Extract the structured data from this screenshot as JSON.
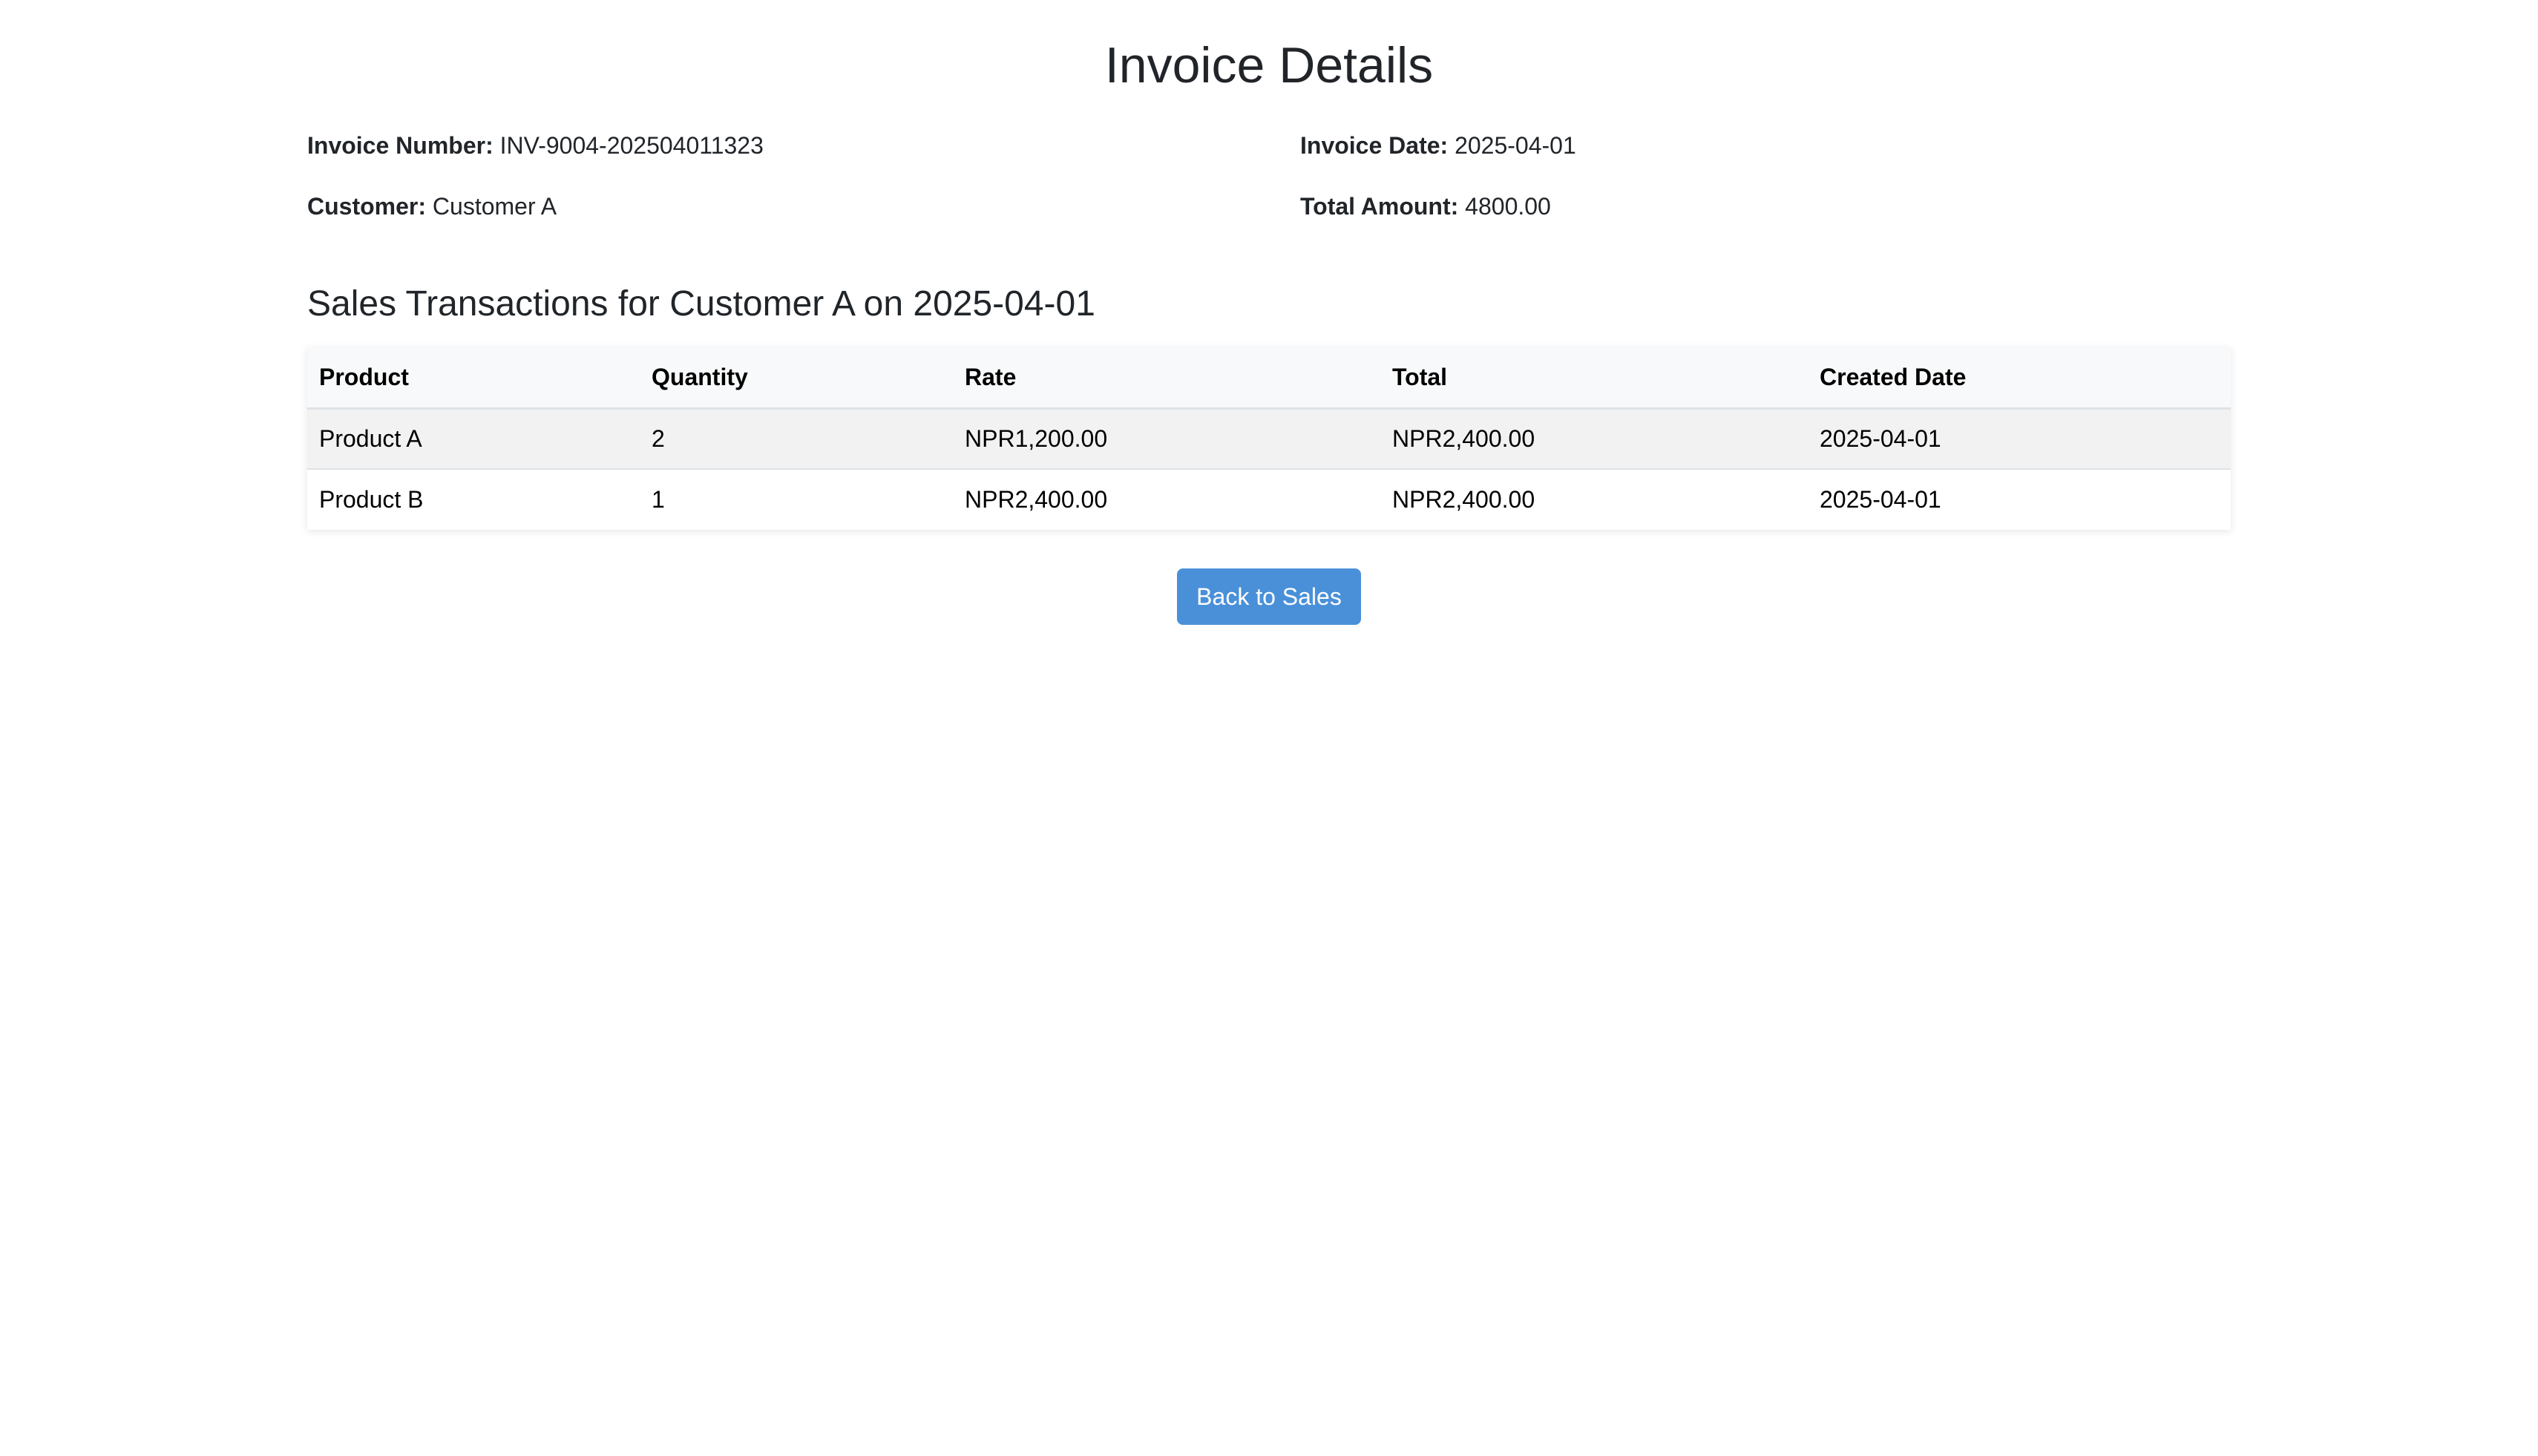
{
  "page": {
    "title": "Invoice Details"
  },
  "invoice": {
    "number_label": "Invoice Number:",
    "number": "INV-9004-202504011323",
    "date_label": "Invoice Date:",
    "date": "2025-04-01",
    "customer_label": "Customer:",
    "customer": "Customer A",
    "total_label": "Total Amount:",
    "total": "4800.00"
  },
  "transactions": {
    "heading": "Sales Transactions for Customer A on 2025-04-01",
    "columns": [
      "Product",
      "Quantity",
      "Rate",
      "Total",
      "Created Date"
    ],
    "rows": [
      [
        "Product A",
        "2",
        "NPR1,200.00",
        "NPR2,400.00",
        "2025-04-01"
      ],
      [
        "Product B",
        "1",
        "NPR2,400.00",
        "NPR2,400.00",
        "2025-04-01"
      ]
    ]
  },
  "actions": {
    "back_label": "Back to Sales"
  },
  "colors": {
    "button_bg": "#4a90d9",
    "header_bg": "#f8f9fa",
    "striped_row_bg": "#f2f2f2"
  }
}
